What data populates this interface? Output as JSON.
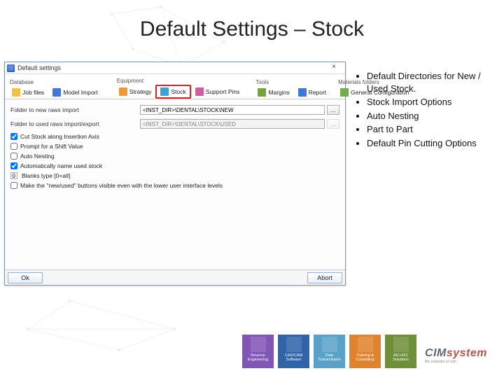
{
  "slide": {
    "title": "Default Settings – Stock"
  },
  "bullets": [
    "Default Directories for New / Used Stock.",
    "Stock Import Options",
    "Auto Nesting",
    "Part to Part",
    "Default Pin Cutting Options"
  ],
  "dialog": {
    "title": "Default settings",
    "close": "×",
    "groups": {
      "database": "Database",
      "equipment": "Equipment",
      "tools": "Tools",
      "materials": "Materials folders"
    },
    "tabs": {
      "jobfiles": {
        "label": "Job files",
        "color": "#f5c04a"
      },
      "modelimport": {
        "label": "Model Import",
        "color": "#3f78d8"
      },
      "strategy": {
        "label": "Strategy",
        "color": "#e99b3a"
      },
      "stock": {
        "label": "Stock",
        "color": "#3fa0d8"
      },
      "supportpins": {
        "label": "Support Pins",
        "color": "#d35c9e"
      },
      "margins": {
        "label": "Margins",
        "color": "#7aa23c"
      },
      "report": {
        "label": "Report",
        "color": "#3f78d8"
      },
      "general": {
        "label": "General Configuration",
        "color": "#6fae4b"
      }
    },
    "fields": {
      "new_label": "Folder to new raws import",
      "new_value": "<INST_DIR>\\DENTAL\\STOCK\\NEW",
      "used_label": "Folder to used raws import/export",
      "used_value": "<INST_DIR>\\DENTAL\\STOCK\\USED"
    },
    "options": {
      "cut_axis": {
        "label": "Cut Stock along Insertion Axis",
        "checked": true
      },
      "prompt": {
        "label": "Prompt for a Shift Value",
        "checked": false
      },
      "autonest": {
        "label": "Auto Nesting",
        "checked": false
      },
      "autoname": {
        "label": "Automatically name used stock",
        "checked": true
      },
      "blanks_val": "0",
      "blanks_lbl": "Blanks type [0=all]",
      "lowui": {
        "label": "Make the \"new/used\" buttons visible even with the lower user interface levels",
        "checked": false
      }
    },
    "buttons": {
      "ok": "Ok",
      "abort": "Abort"
    }
  },
  "footer": {
    "tiles": [
      {
        "label": "Reverse Engineering",
        "color": "#8155b3"
      },
      {
        "label": "CAD/CAM Software",
        "color": "#2f64a8"
      },
      {
        "label": "Data Transmission",
        "color": "#5aa1c9"
      },
      {
        "label": "Training & Consulting",
        "color": "#e0832f"
      },
      {
        "label": "AD HOC Solutions",
        "color": "#6f8f3a"
      }
    ],
    "brand_a": "CIM",
    "brand_b": "system",
    "tagline": "the evolution of cam"
  }
}
